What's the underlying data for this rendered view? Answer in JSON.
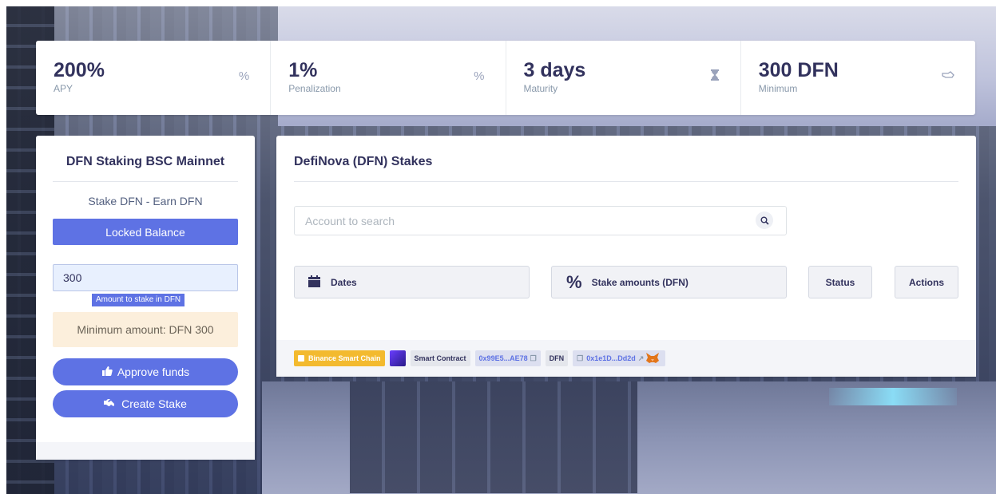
{
  "stats": [
    {
      "value": "200%",
      "label": "APY",
      "icon": "percent-icon",
      "glyph": "%"
    },
    {
      "value": "1%",
      "label": "Penalization",
      "icon": "percent-icon",
      "glyph": "%"
    },
    {
      "value": "3 days",
      "label": "Maturity",
      "icon": "hourglass-icon",
      "glyph": "⌛"
    },
    {
      "value": "300 DFN",
      "label": "Minimum",
      "icon": "hand-coin-icon",
      "glyph": "☜"
    }
  ],
  "left": {
    "title": "DFN Staking BSC Mainnet",
    "subtitle": "Stake DFN - Earn DFN",
    "locked_balance": "Locked Balance",
    "amount_value": "300",
    "amount_badge": "Amount to stake in DFN",
    "minimum_note": "Minimum amount: DFN 300",
    "approve_label": "Approve funds",
    "create_label": "Create Stake"
  },
  "right": {
    "title": "DefiNova (DFN) Stakes",
    "search_placeholder": "Account to search",
    "columns": {
      "dates": "Dates",
      "stake_amounts": "Stake amounts (DFN)",
      "status": "Status",
      "actions": "Actions"
    },
    "footer": {
      "network": "Binance Smart Chain",
      "smart_contract_label": "Smart Contract",
      "contract_address": "0x99E5...AE78",
      "token_label": "DFN",
      "token_address": "0x1e1D...Dd2d"
    }
  },
  "colors": {
    "primary": "#5e72e4",
    "bsc": "#f3ba2f",
    "warning_bg": "#fcefdc"
  }
}
